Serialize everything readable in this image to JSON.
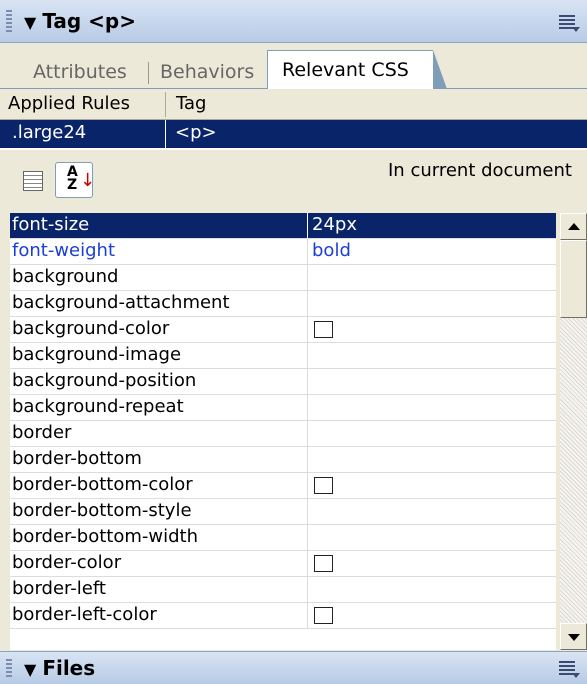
{
  "header": {
    "title": "Tag <p>"
  },
  "tabs": [
    "Attributes",
    "Behaviors",
    "Relevant CSS"
  ],
  "rules_table": {
    "columns": [
      "Applied Rules",
      "Tag"
    ],
    "selected_row": {
      "rule": ".large24",
      "tag": "<p>"
    }
  },
  "toolbar": {
    "location_label": "In current document"
  },
  "properties": [
    {
      "name": "font-size",
      "value": "24px",
      "state": "selected"
    },
    {
      "name": "font-weight",
      "value": "bold",
      "state": "set"
    },
    {
      "name": "background",
      "value": ""
    },
    {
      "name": "background-attachment",
      "value": ""
    },
    {
      "name": "background-color",
      "value": "",
      "swatch": true
    },
    {
      "name": "background-image",
      "value": ""
    },
    {
      "name": "background-position",
      "value": ""
    },
    {
      "name": "background-repeat",
      "value": ""
    },
    {
      "name": "border",
      "value": ""
    },
    {
      "name": "border-bottom",
      "value": ""
    },
    {
      "name": "border-bottom-color",
      "value": "",
      "swatch": true
    },
    {
      "name": "border-bottom-style",
      "value": ""
    },
    {
      "name": "border-bottom-width",
      "value": ""
    },
    {
      "name": "border-color",
      "value": "",
      "swatch": true
    },
    {
      "name": "border-left",
      "value": ""
    },
    {
      "name": "border-left-color",
      "value": "",
      "swatch": true
    }
  ],
  "footer": {
    "title": "Files"
  },
  "colors": {
    "selection": "#0a246a",
    "set_property": "#1a3fd6",
    "panel_bg": "#ece9d8"
  }
}
